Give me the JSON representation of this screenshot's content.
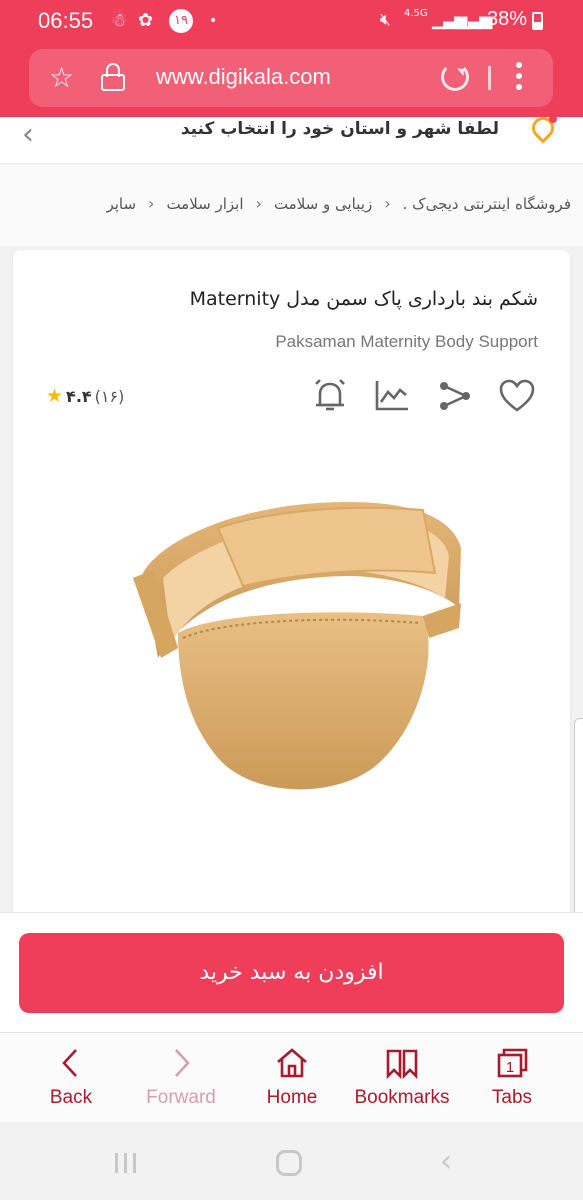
{
  "status_bar": {
    "time": "06:55",
    "notification_badge": "۱۹",
    "network": "4.5G",
    "battery": "38%"
  },
  "browser": {
    "url": "www.digikala.com",
    "bottom_nav": [
      {
        "label": "Back",
        "icon": "chevron-left-icon"
      },
      {
        "label": "Forward",
        "icon": "chevron-right-icon"
      },
      {
        "label": "Home",
        "icon": "home-icon"
      },
      {
        "label": "Bookmarks",
        "icon": "bookmarks-icon"
      },
      {
        "label": "Tabs",
        "icon": "tabs-icon",
        "count": "1"
      }
    ]
  },
  "location": {
    "prompt": "لطفا شهر و استان خود را انتخاب کنید"
  },
  "breadcrumb": {
    "items": [
      "فروشگاه اینترنتی دیجی‌ک .",
      "زیبایی و سلامت",
      "ابزار سلامت",
      "ساپر"
    ]
  },
  "product": {
    "title": "شکم بند بارداری پاک سمن مدل Maternity",
    "subtitle": "Paksaman Maternity Body Support",
    "rating_score": "۴.۴",
    "rating_count": "(۱۶)",
    "actions": [
      "heart-icon",
      "share-icon",
      "chart-icon",
      "bell-icon"
    ]
  },
  "cart": {
    "button_label": "افزودن به سبد خرید"
  },
  "colors": {
    "brand": "#ef3e5a",
    "star": "#f9bc00",
    "nav_active": "#a81b2e"
  }
}
